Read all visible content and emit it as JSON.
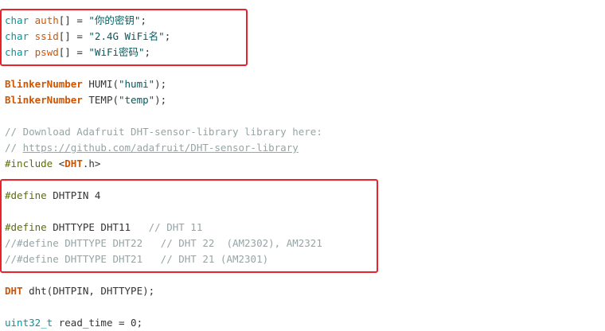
{
  "code": {
    "l1": {
      "type": "char",
      "sp1": " ",
      "var": "auth",
      "rest": "[] = ",
      "str": "\"你的密钥\"",
      "end": ";"
    },
    "l2": {
      "type": "char",
      "sp1": " ",
      "var": "ssid",
      "rest": "[] = ",
      "str": "\"2.4G WiFi名\"",
      "end": ";"
    },
    "l3": {
      "type": "char",
      "sp1": " ",
      "var": "pswd",
      "rest": "[] = ",
      "str": "\"WiFi密码\"",
      "end": ";"
    },
    "l5": {
      "cls": "BlinkerNumber",
      "rest": " HUMI(",
      "str": "\"humi\"",
      "end": ");"
    },
    "l6": {
      "cls": "BlinkerNumber",
      "rest": " TEMP(",
      "str": "\"temp\"",
      "end": ");"
    },
    "l8": {
      "com": "// Download Adafruit DHT-sensor-library library here:"
    },
    "l9": {
      "com": "// ",
      "link": "https://github.com/adafruit/DHT-sensor-library"
    },
    "l10": {
      "pre": "#include",
      "rest": " <",
      "cls": "DHT",
      "end": ".h>"
    },
    "l12": {
      "pre": "#define",
      "rest": " DHTPIN 4"
    },
    "l14": {
      "pre": "#define",
      "rest": " DHTTYPE DHT11   ",
      "com": "// DHT 11"
    },
    "l15": {
      "com": "//#define DHTTYPE DHT22   // DHT 22  (AM2302), AM2321"
    },
    "l16": {
      "com": "//#define DHTTYPE DHT21   // DHT 21 (AM2301)"
    },
    "l18": {
      "cls": "DHT",
      "rest": " dht(DHTPIN, DHTTYPE);"
    },
    "l20": {
      "type": "uint32_t",
      "rest": " read_time = 0;"
    }
  },
  "colors": {
    "highlight_border": "#e8232a",
    "keyword_type": "#00979c",
    "keyword_orange": "#d35400",
    "preprocessor": "#5e6d03",
    "comment": "#95a5a6"
  }
}
